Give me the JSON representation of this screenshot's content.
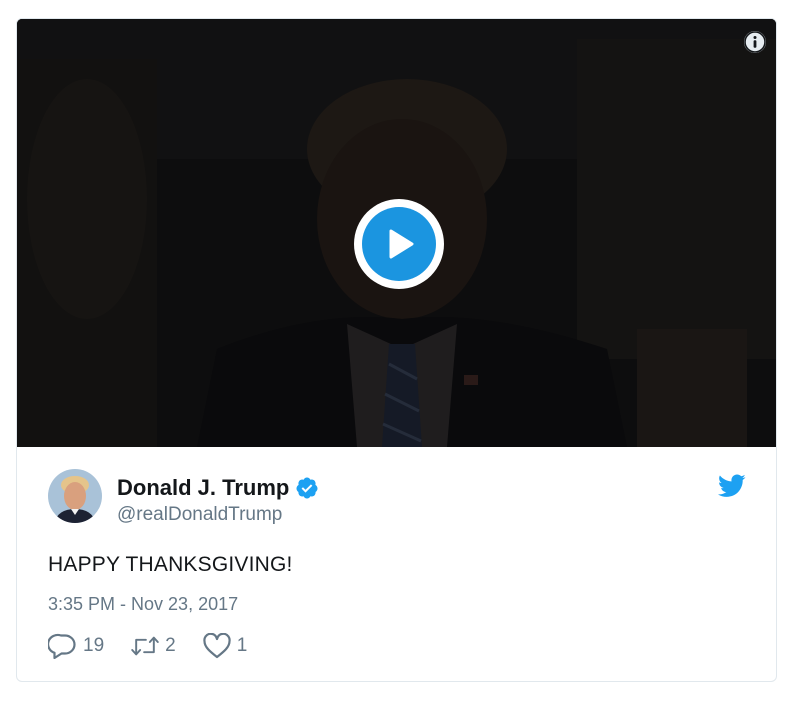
{
  "tweet": {
    "author_name": "Donald J. Trump",
    "handle": "@realDonaldTrump",
    "text": "HAPPY THANKSGIVING!",
    "timestamp": "3:35 PM - Nov 23, 2017",
    "verified": true
  },
  "media": {
    "type": "video",
    "play_icon": "play-icon",
    "info_icon": "info-icon"
  },
  "actions": {
    "reply_count": "19",
    "retweet_count": "2",
    "like_count": "1"
  },
  "colors": {
    "accent": "#1da1f2",
    "play": "#1b95e0",
    "secondary_text": "#657786",
    "primary_text": "#14171a",
    "border": "#e1e8ed"
  }
}
